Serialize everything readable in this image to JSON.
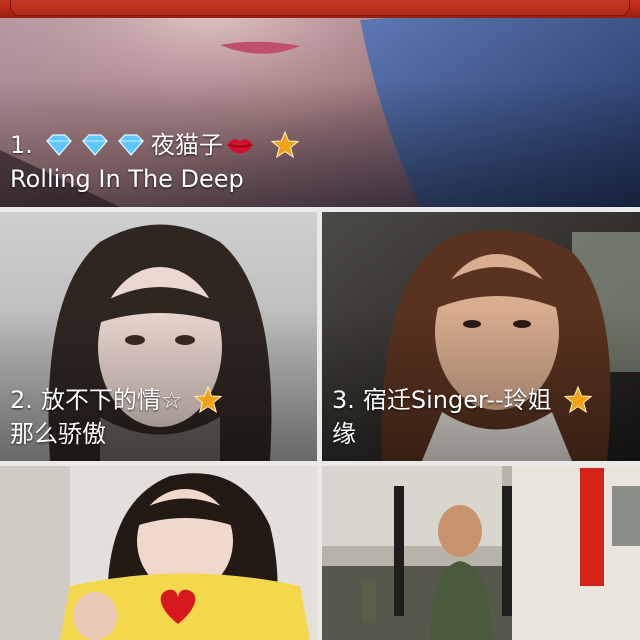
{
  "header": {
    "color": "#b8281a"
  },
  "cards": [
    {
      "rank": "1.",
      "name": "夜猫子",
      "subtitle": "Rolling In The Deep",
      "diamonds": 3,
      "badge": "lips-icon"
    },
    {
      "rank": "2.",
      "name": "放不下的情☆",
      "subtitle": "那么骄傲"
    },
    {
      "rank": "3.",
      "name": "宿迁Singer--玲姐",
      "subtitle": "缘"
    },
    {},
    {}
  ],
  "colors": {
    "star": "#f0a316",
    "diamond": "#5cc8ff",
    "lips": "#d0112b",
    "heart": "#d8181f",
    "sign": "#d3231a"
  }
}
